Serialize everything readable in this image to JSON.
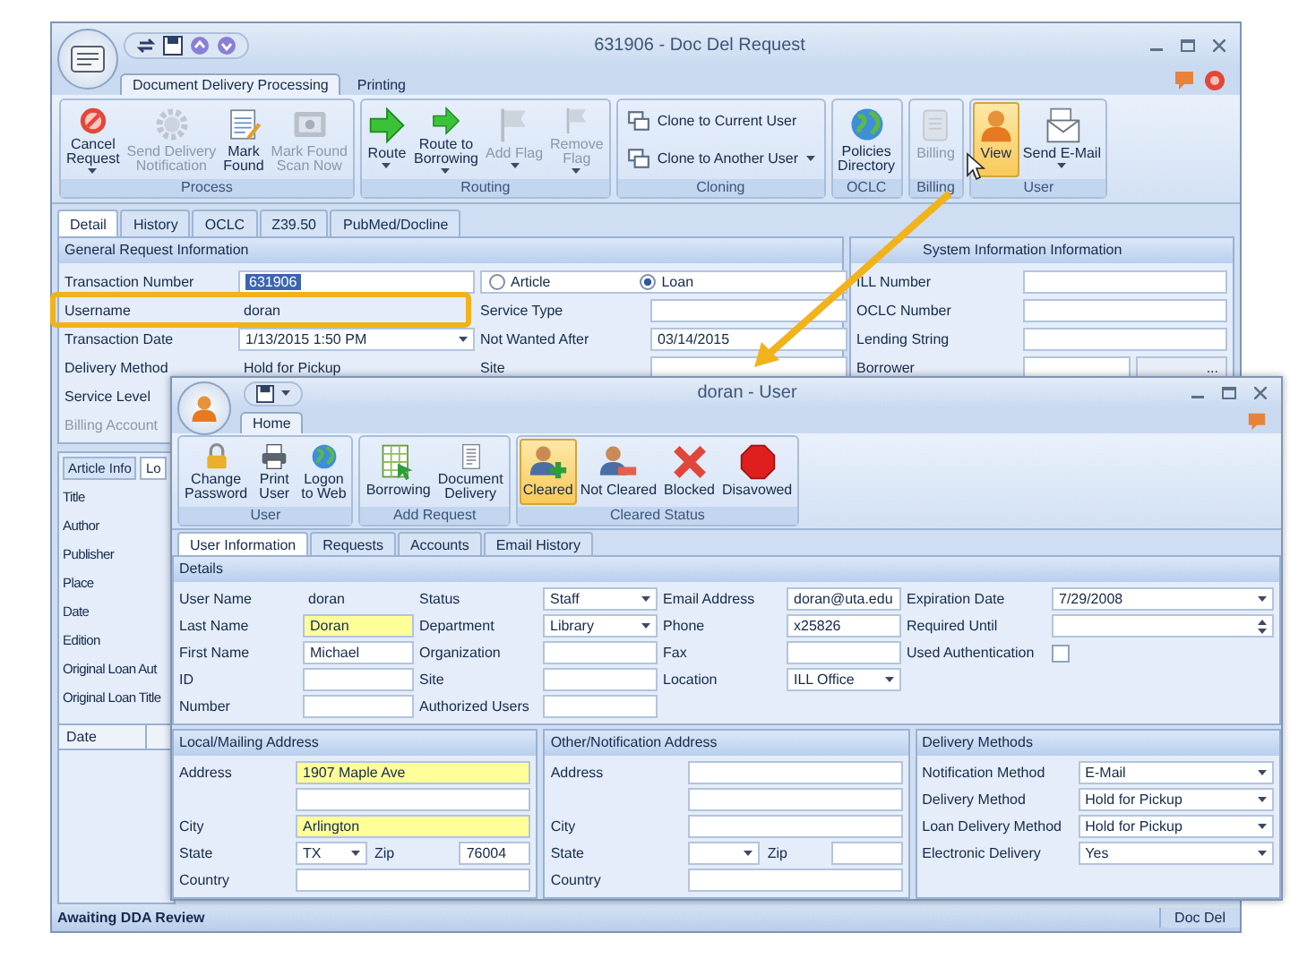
{
  "request_window": {
    "title": "631906 - Doc Del Request",
    "ribbon_tabs": [
      {
        "label": "Document Delivery Processing",
        "selected": true
      },
      {
        "label": "Printing",
        "selected": false
      }
    ],
    "ribbon_groups": [
      {
        "name": "Process",
        "buttons": [
          {
            "label": "Cancel\nRequest",
            "kind": "large",
            "dropdown": true,
            "disabled": false,
            "selected": false
          },
          {
            "label": "Send Delivery\nNotification",
            "kind": "large",
            "dropdown": false,
            "disabled": true,
            "selected": false
          },
          {
            "label": "Mark\nFound",
            "kind": "large",
            "dropdown": false,
            "disabled": false,
            "selected": false
          },
          {
            "label": "Mark Found\nScan Now",
            "kind": "large",
            "dropdown": false,
            "disabled": true,
            "selected": false
          }
        ]
      },
      {
        "name": "Routing",
        "buttons": [
          {
            "label": "Route",
            "kind": "large",
            "dropdown": true,
            "disabled": false,
            "selected": false
          },
          {
            "label": "Route to\nBorrowing",
            "kind": "large",
            "dropdown": true,
            "disabled": false,
            "selected": false
          },
          {
            "label": "Add Flag",
            "kind": "large",
            "dropdown": true,
            "disabled": true,
            "selected": false
          },
          {
            "label": "Remove\nFlag",
            "kind": "large",
            "dropdown": true,
            "disabled": true,
            "selected": false
          }
        ]
      },
      {
        "name": "Cloning",
        "buttons": [
          {
            "label": "Clone to Current User",
            "kind": "small",
            "dropdown": false,
            "disabled": false,
            "selected": false
          },
          {
            "label": "Clone to Another User",
            "kind": "small",
            "dropdown": true,
            "disabled": false,
            "selected": false
          }
        ]
      },
      {
        "name": "OCLC",
        "buttons": [
          {
            "label": "Policies\nDirectory",
            "kind": "large",
            "dropdown": false,
            "disabled": false,
            "selected": false
          }
        ]
      },
      {
        "name": "Billing",
        "buttons": [
          {
            "label": "Billing",
            "kind": "large",
            "dropdown": false,
            "disabled": true,
            "selected": false
          }
        ]
      },
      {
        "name": "User",
        "buttons": [
          {
            "label": "View",
            "kind": "large",
            "dropdown": false,
            "disabled": false,
            "selected": true
          },
          {
            "label": "Send E-Mail",
            "kind": "large",
            "dropdown": true,
            "disabled": false,
            "selected": false
          }
        ]
      }
    ],
    "detail_tabs": [
      {
        "label": "Detail",
        "selected": true
      },
      {
        "label": "History",
        "selected": false
      },
      {
        "label": "OCLC",
        "selected": false
      },
      {
        "label": "Z39.50",
        "selected": false
      },
      {
        "label": "PubMed/Docline",
        "selected": false
      }
    ],
    "general": {
      "title": "General Request Information",
      "rows": [
        {
          "label": "Transaction Number",
          "value": "631906",
          "kind": "text",
          "value_selected": true
        },
        {
          "label": "Username",
          "value": "doran",
          "kind": "readonly",
          "value_selected": false
        },
        {
          "label": "Transaction Date",
          "value": "1/13/2015 1:50 PM",
          "kind": "dropdown",
          "value_selected": false
        },
        {
          "label": "Delivery Method",
          "value": "Hold for Pickup",
          "kind": "readonly",
          "value_selected": false
        }
      ],
      "more_labels": [
        {
          "label": "Service Level",
          "disabled": false
        },
        {
          "label": "Billing Account",
          "disabled": true
        }
      ],
      "options": [
        {
          "label": "Article",
          "selected": false
        },
        {
          "label": "Loan",
          "selected": true
        }
      ],
      "right_rows": [
        {
          "label": "Service Type"
        },
        {
          "label": "Not Wanted After",
          "value": "03/14/2015"
        },
        {
          "label": "Site"
        }
      ]
    },
    "system": {
      "title": "System Information Information",
      "rows": [
        {
          "label": "ILL Number"
        },
        {
          "label": "OCLC Number"
        },
        {
          "label": "Lending String"
        },
        {
          "label": "Borrower",
          "button": "..."
        }
      ]
    },
    "item_tabs": [
      {
        "label": "Article Info",
        "selected": false
      },
      {
        "label": "Lo",
        "selected": true
      }
    ],
    "item_labels": [
      "Title",
      "Author",
      "Publisher",
      "Place",
      "Date",
      "Edition",
      "Original Loan Aut",
      "Original Loan Title"
    ],
    "table_columns": [
      "Date"
    ],
    "status": "Awaiting DDA Review",
    "status_right": "Doc Del"
  },
  "user_window": {
    "title": "doran - User",
    "ribbon_tabs": [
      {
        "label": "Home",
        "selected": true
      }
    ],
    "ribbon_groups": [
      {
        "name": "User",
        "buttons": [
          {
            "label": "Change\nPassword",
            "selected": false
          },
          {
            "label": "Print\nUser",
            "selected": false
          },
          {
            "label": "Logon\nto Web",
            "selected": false
          }
        ]
      },
      {
        "name": "Add Request",
        "buttons": [
          {
            "label": "Borrowing",
            "selected": false
          },
          {
            "label": "Document\nDelivery",
            "selected": false
          }
        ]
      },
      {
        "name": "Cleared Status",
        "buttons": [
          {
            "label": "Cleared",
            "selected": true
          },
          {
            "label": "Not Cleared",
            "selected": false
          },
          {
            "label": "Blocked",
            "selected": false
          },
          {
            "label": "Disavowed",
            "selected": false
          }
        ]
      }
    ],
    "tabs": [
      {
        "label": "User Information",
        "selected": true
      },
      {
        "label": "Requests",
        "selected": false
      },
      {
        "label": "Accounts",
        "selected": false
      },
      {
        "label": "Email History",
        "selected": false
      }
    ],
    "details": {
      "title": "Details",
      "columns": [
        [
          {
            "label": "User Name",
            "value": "doran",
            "kind": "readonly",
            "required": false
          },
          {
            "label": "Last Name",
            "value": "Doran",
            "kind": "text",
            "required": true
          },
          {
            "label": "First Name",
            "value": "Michael",
            "kind": "text",
            "required": false
          },
          {
            "label": "ID",
            "kind": "text",
            "required": false
          },
          {
            "label": "Number",
            "kind": "text",
            "required": false
          }
        ],
        [
          {
            "label": "Status",
            "value": "Staff",
            "kind": "dropdown",
            "required": false
          },
          {
            "label": "Department",
            "value": "Library",
            "kind": "dropdown",
            "required": false
          },
          {
            "label": "Organization",
            "kind": "text",
            "required": false
          },
          {
            "label": "Site",
            "kind": "text",
            "required": false
          },
          {
            "label": "Authorized Users",
            "kind": "text",
            "required": false
          }
        ],
        [
          {
            "label": "Email Address",
            "value": "doran@uta.edu",
            "kind": "text",
            "required": false
          },
          {
            "label": "Phone",
            "value": "x25826",
            "kind": "text",
            "required": false
          },
          {
            "label": "Fax",
            "kind": "text",
            "required": false
          },
          {
            "label": "Location",
            "value": "ILL Office",
            "kind": "dropdown",
            "required": false
          }
        ],
        [
          {
            "label": "Expiration Date",
            "value": "7/29/2008",
            "kind": "dropdown",
            "required": false
          },
          {
            "label": "Required Until",
            "kind": "spin",
            "required": false
          },
          {
            "label": "Used Authentication",
            "kind": "check",
            "required": false,
            "checked": false
          }
        ]
      ]
    },
    "panels": [
      {
        "title": "Local/Mailing Address",
        "rows": [
          {
            "kind": "text",
            "label": "Address",
            "value": "1907 Maple Ave",
            "required": true
          },
          {
            "kind": "text",
            "required": false
          },
          {
            "kind": "text",
            "label": "City",
            "value": "Arlington",
            "required": true
          },
          {
            "kind": "state_zip",
            "label": "State",
            "value": "TX",
            "zip_label": "Zip",
            "zip_value": "76004",
            "required": false
          },
          {
            "kind": "text",
            "label": "Country",
            "required": false
          }
        ]
      },
      {
        "title": "Other/Notification Address",
        "rows": [
          {
            "kind": "text",
            "label": "Address",
            "required": false
          },
          {
            "kind": "text",
            "required": false
          },
          {
            "kind": "text",
            "label": "City",
            "required": false
          },
          {
            "kind": "state_zip",
            "label": "State",
            "zip_label": "Zip",
            "required": false
          },
          {
            "kind": "text",
            "label": "Country",
            "required": false
          }
        ]
      },
      {
        "title": "Delivery Methods",
        "rows": [
          {
            "kind": "dropdown",
            "label": "Notification Method",
            "value": "E-Mail",
            "required": false
          },
          {
            "kind": "dropdown",
            "label": "Delivery Method",
            "value": "Hold for Pickup",
            "required": false
          },
          {
            "kind": "dropdown",
            "label": "Loan Delivery Method",
            "value": "Hold for Pickup",
            "required": false
          },
          {
            "kind": "dropdown",
            "label": "Electronic Delivery",
            "value": "Yes",
            "required": false
          }
        ]
      }
    ]
  }
}
